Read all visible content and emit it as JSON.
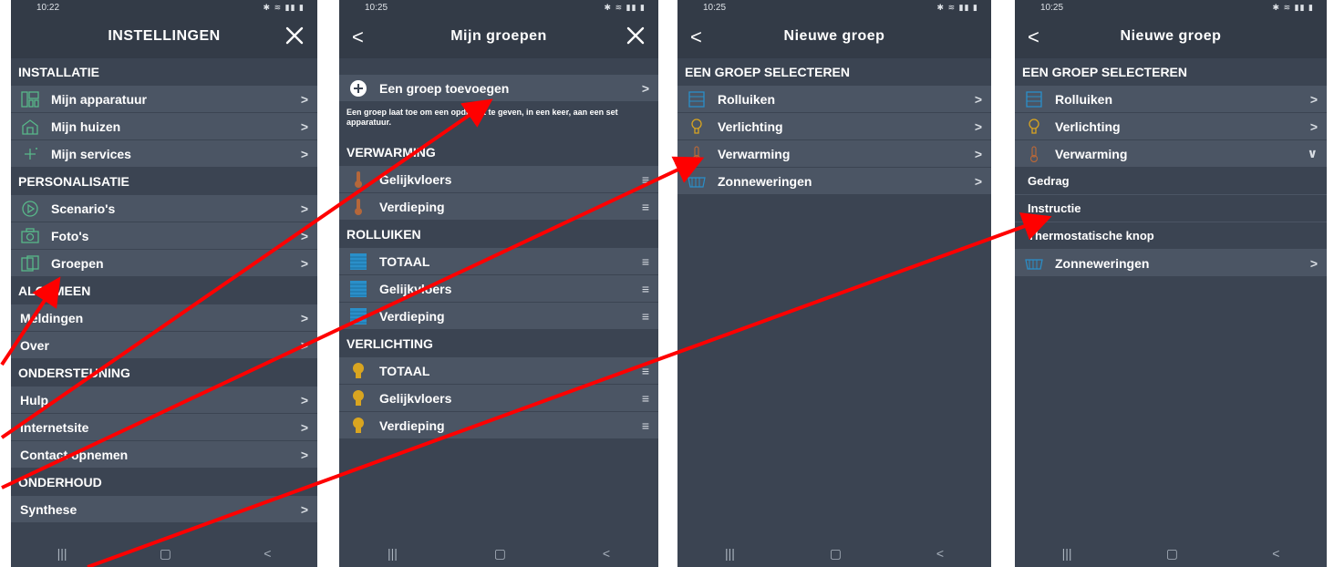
{
  "screen1": {
    "time": "10:22",
    "title": "INSTELLINGEN",
    "sections": [
      {
        "label": "INSTALLATIE",
        "items": [
          "Mijn apparatuur",
          "Mijn huizen",
          "Mijn services"
        ]
      },
      {
        "label": "PERSONALISATIE",
        "items": [
          "Scenario's",
          "Foto's",
          "Groepen"
        ]
      },
      {
        "label": "ALGEMEEN",
        "items": [
          "Meldingen",
          "Over"
        ]
      },
      {
        "label": "ONDERSTEUNING",
        "items": [
          "Hulp",
          "Internetsite",
          "Contact opnemen"
        ]
      },
      {
        "label": "ONDERHOUD",
        "items": [
          "Synthese"
        ]
      }
    ]
  },
  "screen2": {
    "time": "10:25",
    "title": "Mijn groepen",
    "add_label": "Een groep toevoegen",
    "description": "Een groep laat toe om een opdracht te geven, in een keer, aan een set apparatuur.",
    "sections": [
      {
        "label": "VERWARMING",
        "items": [
          "Gelijkvloers",
          "Verdieping"
        ]
      },
      {
        "label": "ROLLUIKEN",
        "items": [
          "TOTAAL",
          "Gelijkvloers",
          "Verdieping"
        ]
      },
      {
        "label": "VERLICHTING",
        "items": [
          "TOTAAL",
          "Gelijkvloers",
          "Verdieping"
        ]
      }
    ]
  },
  "screen3": {
    "time": "10:25",
    "title": "Nieuwe groep",
    "section": "EEN GROEP SELECTEREN",
    "items": [
      "Rolluiken",
      "Verlichting",
      "Verwarming",
      "Zonneweringen"
    ]
  },
  "screen4": {
    "time": "10:25",
    "title": "Nieuwe groep",
    "section": "EEN GROEP SELECTEREN",
    "items": [
      "Rolluiken",
      "Verlichting",
      "Verwarming"
    ],
    "subitems": [
      "Gedrag",
      "Instructie",
      "Thermostatische knop"
    ],
    "last_item": "Zonneweringen"
  },
  "colors": {
    "background": "#3b4452",
    "row": "#4b5564",
    "header": "#333b47",
    "accent_blue": "#2a8fc9",
    "heating": "#b5673a",
    "light": "#d9a520",
    "green": "#58b88a",
    "arrow": "#ff0000"
  }
}
